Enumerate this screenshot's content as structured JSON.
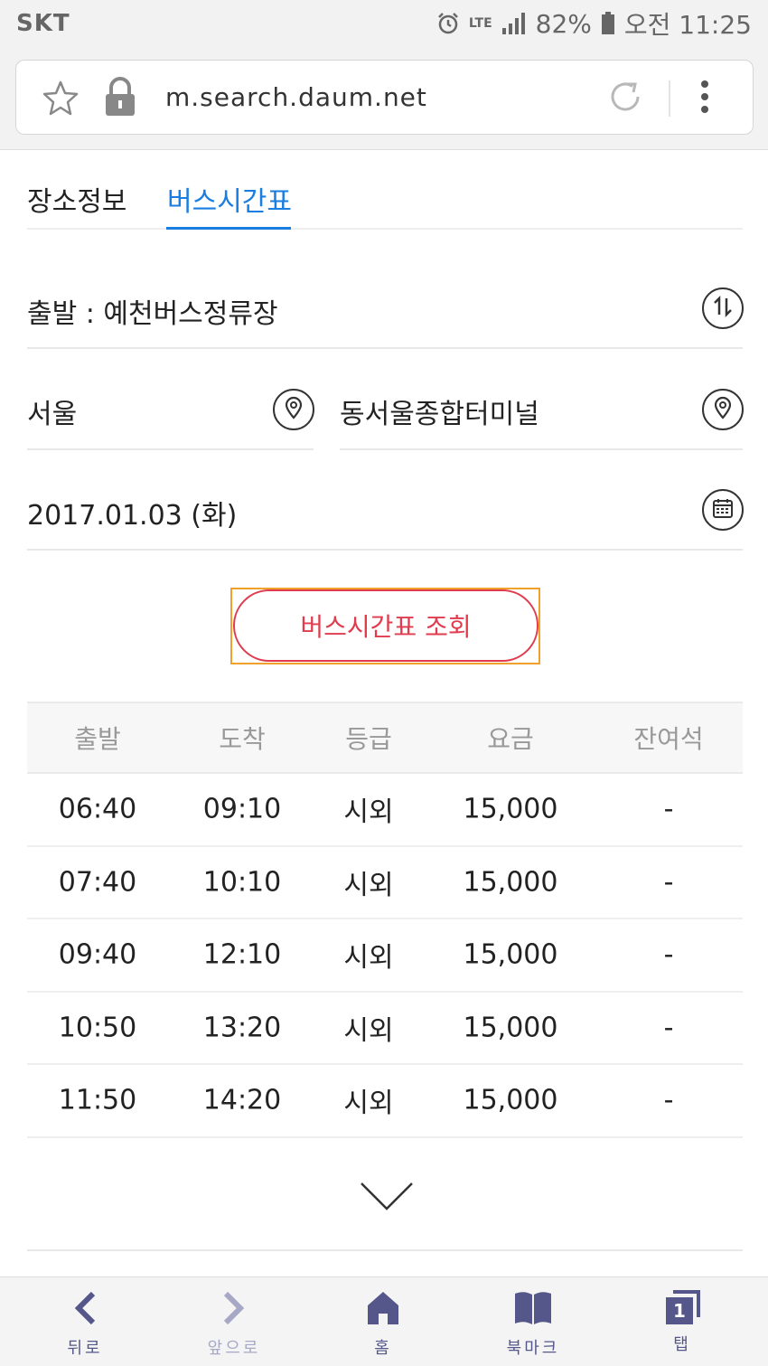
{
  "status_bar": {
    "carrier": "SKT",
    "network": "LTE",
    "battery": "82%",
    "time": "오전 11:25"
  },
  "browser": {
    "url": "m.search.daum.net"
  },
  "tabs": [
    {
      "label": "장소정보",
      "active": false
    },
    {
      "label": "버스시간표",
      "active": true
    }
  ],
  "form": {
    "departure": "출발 : 예천버스정류장",
    "from_city": "서울",
    "to_terminal": "동서울종합터미널",
    "date": "2017.01.03 (화)",
    "search_button": "버스시간표 조회"
  },
  "timetable": {
    "headers": [
      "출발",
      "도착",
      "등급",
      "요금",
      "잔여석"
    ],
    "rows": [
      [
        "06:40",
        "09:10",
        "시외",
        "15,000",
        "-"
      ],
      [
        "07:40",
        "10:10",
        "시외",
        "15,000",
        "-"
      ],
      [
        "09:40",
        "12:10",
        "시외",
        "15,000",
        "-"
      ],
      [
        "10:50",
        "13:20",
        "시외",
        "15,000",
        "-"
      ],
      [
        "11:50",
        "14:20",
        "시외",
        "15,000",
        "-"
      ]
    ]
  },
  "bottom_nav": [
    {
      "label": "뒤로",
      "icon": "back-icon"
    },
    {
      "label": "앞으로",
      "icon": "forward-icon"
    },
    {
      "label": "홈",
      "icon": "home-icon"
    },
    {
      "label": "북마크",
      "icon": "bookmark-icon"
    },
    {
      "label": "탭",
      "icon": "tabs-icon",
      "count": "1"
    }
  ],
  "colors": {
    "accent_blue": "#1a7de0",
    "search_red": "#e03c4e",
    "nav_purple": "#55578a"
  }
}
